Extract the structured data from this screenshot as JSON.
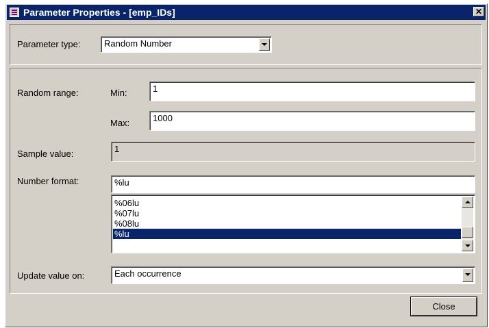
{
  "window": {
    "title": "Parameter Properties - [emp_IDs]",
    "close_glyph": "✕"
  },
  "param_type": {
    "label": "Parameter type:",
    "value": "Random Number"
  },
  "random_range": {
    "label": "Random range:",
    "min_label": "Min:",
    "min_value": "1",
    "max_label": "Max:",
    "max_value": "1000"
  },
  "sample": {
    "label": "Sample value:",
    "value": "1"
  },
  "number_format": {
    "label": "Number format:",
    "value": "%lu",
    "options": [
      "%06lu",
      "%07lu",
      "%08lu",
      "%lu"
    ],
    "selected_index": 3
  },
  "update": {
    "label": "Update value on:",
    "value": "Each occurrence"
  },
  "footer": {
    "close_label": "Close"
  },
  "icons": {
    "window_icon": "parameter-table-icon",
    "combo_arrow": "chevron-down-icon",
    "scroll_up": "arrow-up-icon",
    "scroll_down": "arrow-down-icon"
  }
}
